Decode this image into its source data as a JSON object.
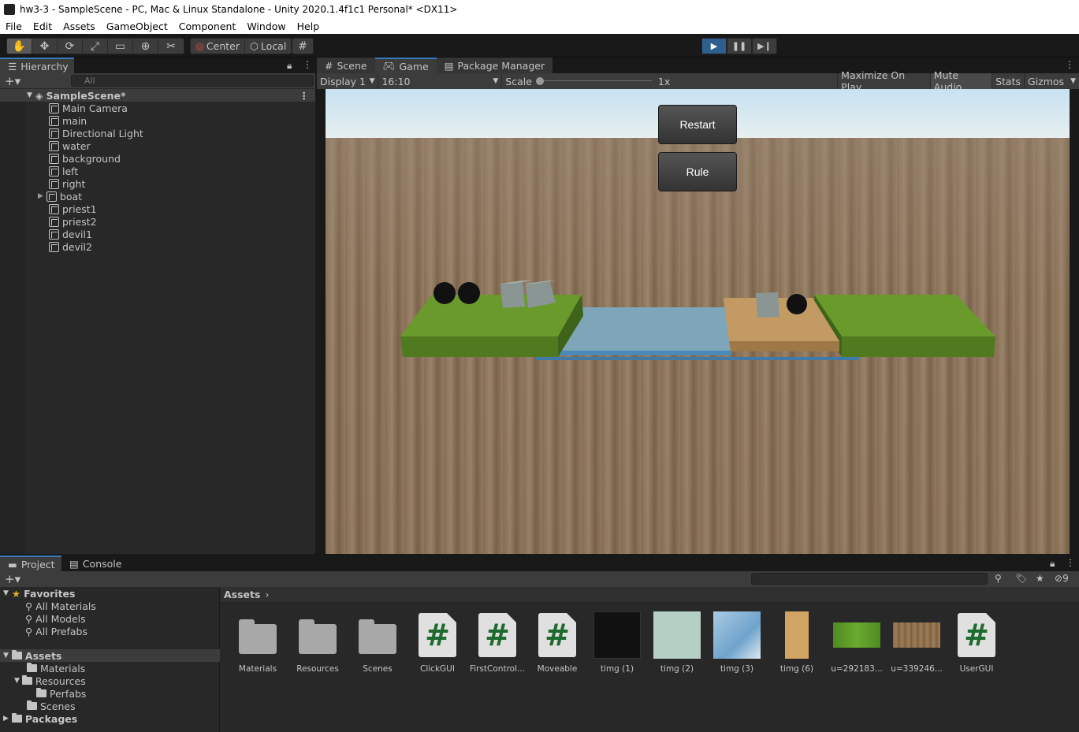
{
  "window_title": "hw3-3 - SampleScene - PC, Mac & Linux Standalone - Unity 2020.1.4f1c1 Personal* <DX11>",
  "menu": [
    "File",
    "Edit",
    "Assets",
    "GameObject",
    "Component",
    "Window",
    "Help"
  ],
  "toolbar": {
    "center_label": "Center",
    "local_label": "Local"
  },
  "hierarchy": {
    "tab_label": "Hierarchy",
    "search_placeholder": "All",
    "scene_name": "SampleScene*",
    "objects": [
      "Main Camera",
      "main",
      "Directional Light",
      "water",
      "background",
      "left",
      "right",
      "boat",
      "priest1",
      "priest2",
      "devil1",
      "devil2"
    ]
  },
  "view_tabs": {
    "scene": "Scene",
    "game": "Game",
    "package_manager": "Package Manager"
  },
  "game_bar": {
    "display": "Display 1",
    "aspect": "16:10",
    "scale_label": "Scale",
    "scale_value": "1x",
    "maximize": "Maximize On Play",
    "mute": "Mute Audio",
    "stats": "Stats",
    "gizmos": "Gizmos"
  },
  "game_gui": {
    "restart": "Restart",
    "rule": "Rule"
  },
  "project_tabs": {
    "project": "Project",
    "console": "Console"
  },
  "project_tree": {
    "favorites": "Favorites",
    "fav_items": [
      "All Materials",
      "All Models",
      "All Prefabs"
    ],
    "assets": "Assets",
    "materials": "Materials",
    "resources": "Resources",
    "perfabs": "Perfabs",
    "scenes": "Scenes",
    "packages": "Packages"
  },
  "hidden_count": "9",
  "breadcrumb": "Assets",
  "assets": [
    {
      "name": "Materials",
      "kind": "folder"
    },
    {
      "name": "Resources",
      "kind": "folder"
    },
    {
      "name": "Scenes",
      "kind": "folder"
    },
    {
      "name": "ClickGUI",
      "kind": "script"
    },
    {
      "name": "FirstControl...",
      "kind": "script"
    },
    {
      "name": "Moveable",
      "kind": "script"
    },
    {
      "name": "timg (1)",
      "kind": "texture",
      "color": "#111111"
    },
    {
      "name": "timg (2)",
      "kind": "texture",
      "color": "#b5cfc4"
    },
    {
      "name": "timg (3)",
      "kind": "texture",
      "color": "#8fb8d8"
    },
    {
      "name": "timg (6)",
      "kind": "texture",
      "color": "#d2a464"
    },
    {
      "name": "u=292183...",
      "kind": "texture",
      "color": "#5a9a2a"
    },
    {
      "name": "u=339246...",
      "kind": "texture",
      "color": "#8a6a48"
    },
    {
      "name": "UserGUI",
      "kind": "script"
    }
  ]
}
